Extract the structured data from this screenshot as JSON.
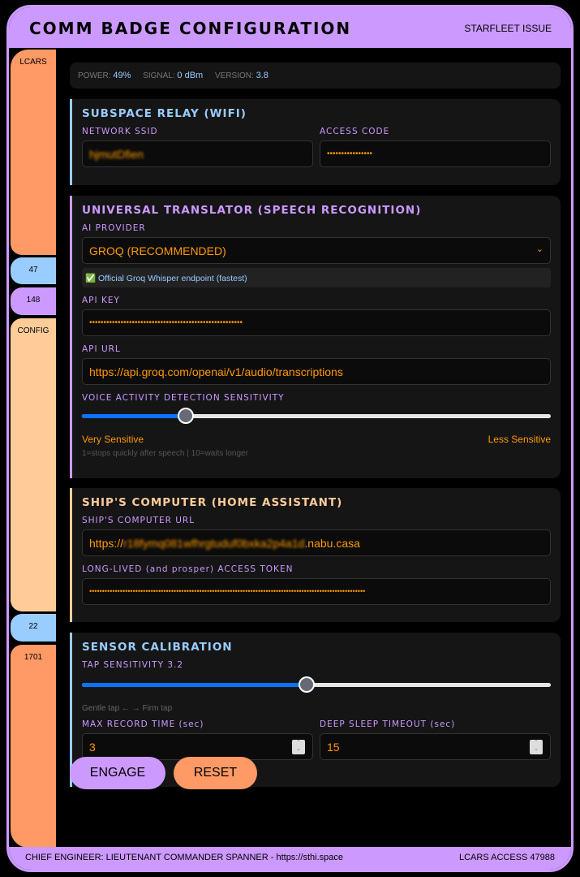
{
  "header": {
    "title": "COMM BADGE CONFIGURATION",
    "subtitle": "STARFLEET ISSUE"
  },
  "sidebar": [
    {
      "label": "LCARS",
      "color": "#ff9966"
    },
    {
      "label": "47",
      "color": "#99ccff"
    },
    {
      "label": "148",
      "color": "#cc99ff"
    },
    {
      "label": "CONFIG",
      "color": "#ffcc99"
    },
    {
      "label": "22",
      "color": "#99ccff"
    },
    {
      "label": "1701",
      "color": "#ff9966"
    }
  ],
  "status": {
    "power_label": "POWER:",
    "power": "49%",
    "signal_label": "SIGNAL:",
    "signal": "0 dBm",
    "version_label": "VERSION:",
    "version": "3.8"
  },
  "wifi": {
    "title": "SUBSPACE RELAY (WIFI)",
    "ssid_label": "NETWORK SSID",
    "ssid": "hjmutDfien",
    "code_label": "ACCESS CODE",
    "code": "••••••••••••••••"
  },
  "translator": {
    "title": "UNIVERSAL TRANSLATOR (SPEECH RECOGNITION)",
    "provider_label": "AI PROVIDER",
    "provider": "GROQ (RECOMMENDED)",
    "provider_note": "✅ Official Groq Whisper endpoint (fastest)",
    "key_label": "API KEY",
    "key": "••••••••••••••••••••••••••••••••••••••••••••••••••••••",
    "url_label": "API URL",
    "url": "https://api.groq.com/openai/v1/audio/transcriptions",
    "vad_label": "VOICE ACTIVITY DETECTION SENSITIVITY",
    "vad_value": 3,
    "vad_min": 1,
    "vad_max": 10,
    "vad_left": "Very Sensitive",
    "vad_right": "Less Sensitive",
    "vad_hint": "1=stops quickly after speech | 10=waits longer"
  },
  "ship": {
    "title": "SHIP'S COMPUTER (HOME ASSISTANT)",
    "url_label": "SHIP'S COMPUTER URL",
    "url_prefix": "https://",
    "url_hidden": "r18fymq081wfhrgtuduf0bxka2p4a1d",
    "url_suffix": ".nabu.casa",
    "token_label": "LONG-LIVED (and prosper) ACCESS TOKEN",
    "token": "••••••••••••••••••••••••••••••••••••••••••••••••••••••••••••••••••••••••••••••••••••••••••••••••••••••••••••"
  },
  "sensor": {
    "title": "SENSOR CALIBRATION",
    "tap_label": "TAP SENSITIVITY 3.2",
    "tap_fraction": 0.48,
    "tap_hint": "Gentle tap ← → Firm tap",
    "record_label": "MAX RECORD TIME (sec)",
    "record": "3",
    "sleep_label": "DEEP SLEEP TIMEOUT (sec)",
    "sleep": "15"
  },
  "buttons": {
    "engage": "ENGAGE",
    "reset": "RESET"
  },
  "footer": {
    "credit": "CHIEF ENGINEER: LIEUTENANT COMMANDER SPANNER - https://sthi.space",
    "access": "LCARS ACCESS 47988"
  },
  "colors": {
    "purple": "#cc99ff",
    "orange": "#ff9966",
    "blue": "#99ccff",
    "peach": "#ffcc99",
    "value": "#ff9900"
  }
}
